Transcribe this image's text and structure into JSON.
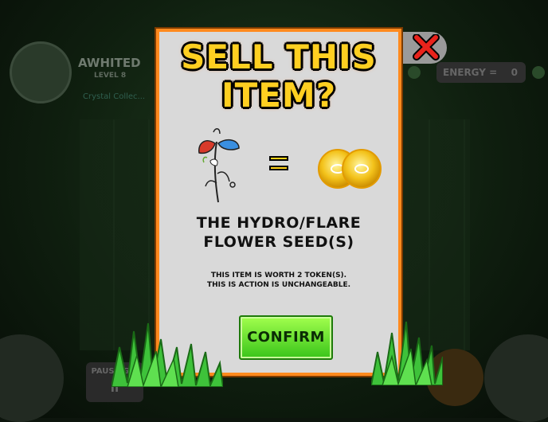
{
  "background": {
    "player_name": "AWHITED",
    "level": "LEVEL 8",
    "subtitle": "Crystal Collec...",
    "energy_label": "ENERGY =",
    "energy_value": "0",
    "pause_label": "PAUSE G...",
    "pause_value": "II"
  },
  "modal": {
    "title_line1": "SELL THIS",
    "title_line2": "ITEM?",
    "item_name_line1": "THE HYDRO/FLARE",
    "item_name_line2": "FLOWER SEED(S)",
    "note_line1": "THIS ITEM IS WORTH 2 TOKEN(S).",
    "note_line2": "THIS IS ACTION IS UNCHANGEABLE.",
    "confirm_label": "CONFIRM",
    "token_count": 2
  },
  "icons": {
    "close": "close-x-icon",
    "item": "flower-seed-icon",
    "token": "token-coin-icon"
  },
  "colors": {
    "modal_border": "#ff8a1e",
    "title_fill": "#ffcf21",
    "confirm_green": "#39c41a",
    "close_red": "#e8231c"
  }
}
